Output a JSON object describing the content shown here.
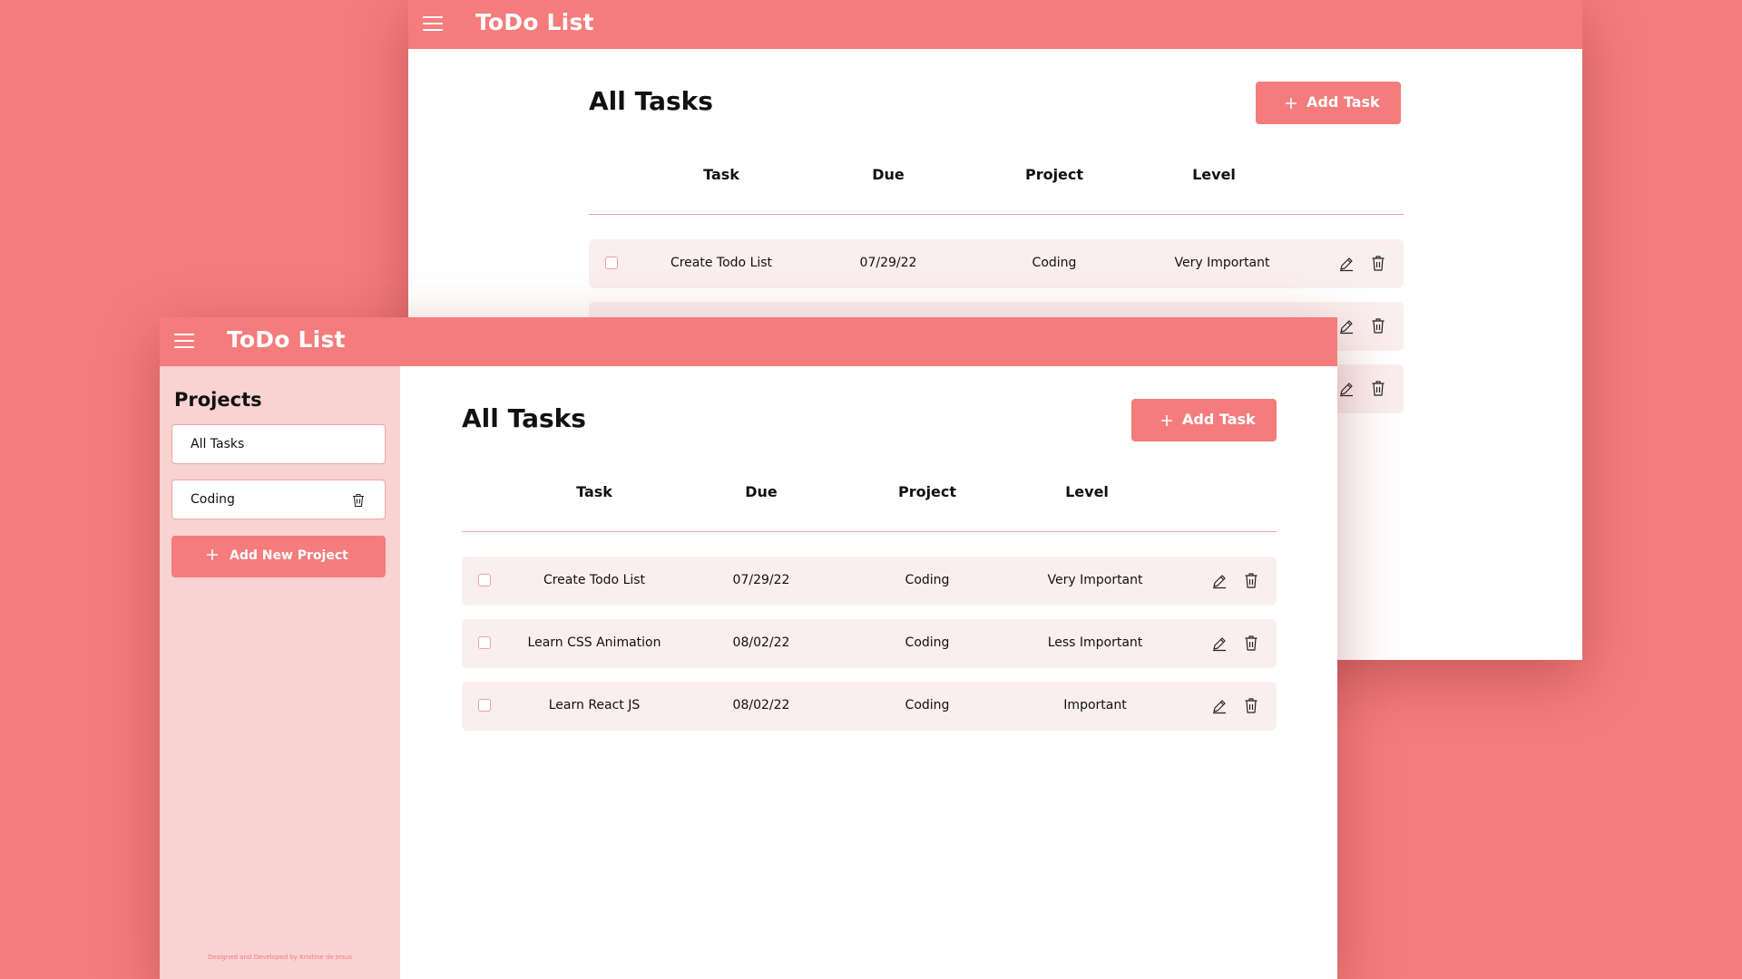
{
  "app": {
    "title": "ToDo List"
  },
  "sidebar": {
    "title": "Projects",
    "projects": [
      {
        "label": "All Tasks"
      },
      {
        "label": "Coding"
      }
    ],
    "add_project_label": "Add New Project",
    "credit": "Designed and Developed by Kristine de Jesus"
  },
  "main": {
    "title": "All Tasks",
    "add_task_label": "Add Task",
    "columns": [
      "Task",
      "Due",
      "Project",
      "Level"
    ],
    "tasks": [
      {
        "task": "Create Todo List",
        "due": "07/29/22",
        "project": "Coding",
        "level": "Very Important",
        "done": false
      },
      {
        "task": "Learn CSS Animation",
        "due": "08/02/22",
        "project": "Coding",
        "level": "Less Important",
        "done": false
      },
      {
        "task": "Learn React JS",
        "due": "08/02/22",
        "project": "Coding",
        "level": "Important",
        "done": false
      }
    ]
  },
  "icons": {
    "menu": "hamburger-menu-icon",
    "add": "plus-icon",
    "edit": "pencil-icon",
    "delete": "trash-icon"
  },
  "colors": {
    "accent": "#f47c7c",
    "sidebar_bg": "#f9d2d2",
    "row_bg": "#fbeeee",
    "surface": "#ffffff"
  }
}
